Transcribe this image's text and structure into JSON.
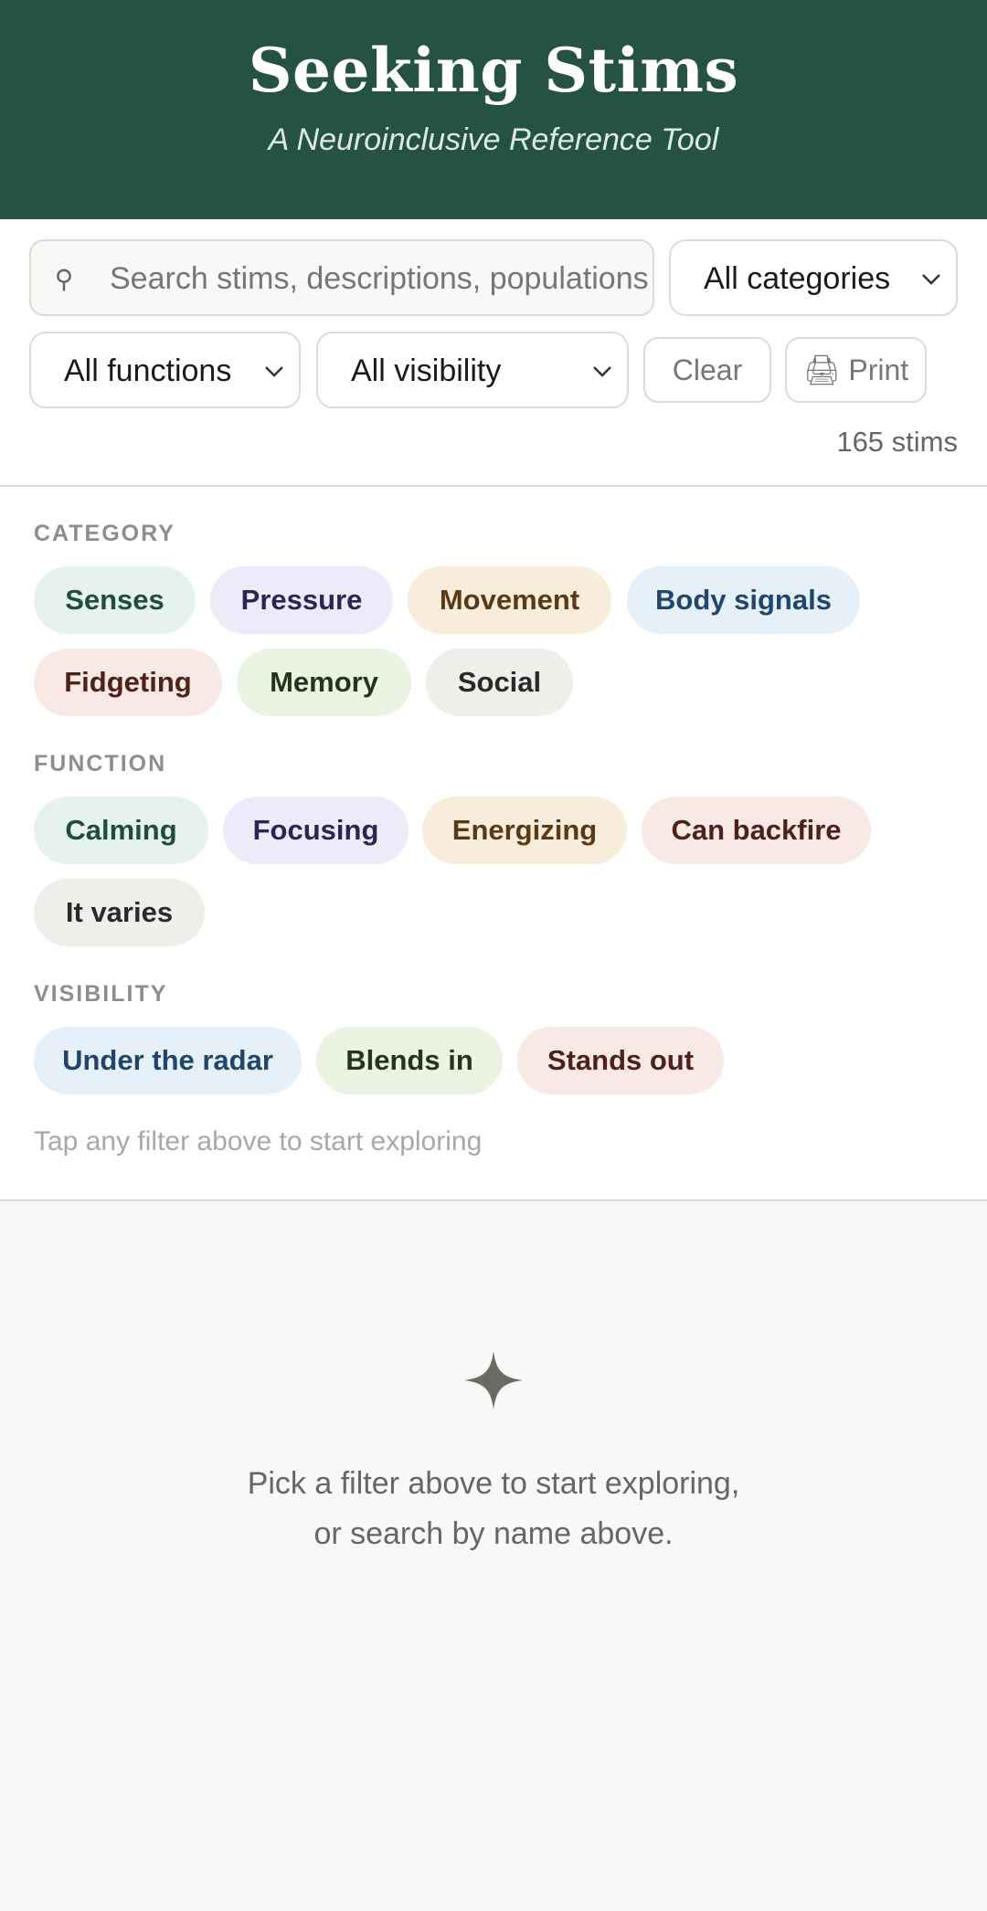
{
  "header": {
    "title": "Seeking Stims",
    "subtitle": "A Neuroinclusive Reference Tool"
  },
  "search": {
    "placeholder": "Search stims, descriptions, populations…",
    "icon": "search-icon"
  },
  "selects": {
    "categories": "All categories",
    "functions": "All functions",
    "visibility": "All visibility"
  },
  "buttons": {
    "clear": "Clear",
    "print": "🖨 Print"
  },
  "count_label": "165 stims",
  "filters": {
    "category": {
      "label": "CATEGORY",
      "chips": [
        {
          "label": "Senses",
          "bg": "#e6f3ed",
          "fg": "#1f4d3f"
        },
        {
          "label": "Pressure",
          "bg": "#ecebfa",
          "fg": "#2a2555"
        },
        {
          "label": "Movement",
          "bg": "#f8ecda",
          "fg": "#5a3a16"
        },
        {
          "label": "Body signals",
          "bg": "#e6f0f9",
          "fg": "#21466b"
        },
        {
          "label": "Fidgeting",
          "bg": "#f8e9e6",
          "fg": "#4e2219"
        },
        {
          "label": "Memory",
          "bg": "#ebf3e2",
          "fg": "#24361a"
        },
        {
          "label": "Social",
          "bg": "#efeeeb",
          "fg": "#2a2a2a"
        }
      ]
    },
    "function": {
      "label": "FUNCTION",
      "chips": [
        {
          "label": "Calming",
          "bg": "#e6f3ed",
          "fg": "#1f4d3f"
        },
        {
          "label": "Focusing",
          "bg": "#ecebfa",
          "fg": "#2a2555"
        },
        {
          "label": "Energizing",
          "bg": "#f8ecda",
          "fg": "#5a3a16"
        },
        {
          "label": "Can backfire",
          "bg": "#f8e9e6",
          "fg": "#4e2219"
        },
        {
          "label": "It varies",
          "bg": "#efeeeb",
          "fg": "#2a2a2a"
        }
      ]
    },
    "visibility": {
      "label": "VISIBILITY",
      "chips": [
        {
          "label": "Under the radar",
          "bg": "#e6f0f9",
          "fg": "#21466b"
        },
        {
          "label": "Blends in",
          "bg": "#ebf3e2",
          "fg": "#24361a"
        },
        {
          "label": "Stands out",
          "bg": "#f8e9e6",
          "fg": "#4e2219"
        }
      ]
    },
    "hint": "Tap any filter above to start exploring"
  },
  "empty_state": {
    "icon": "sparkle-icon",
    "line1": "Pick a filter above to start exploring,",
    "line2": "or search by name above."
  },
  "colors": {
    "header_bg": "#265244",
    "page_bg": "#f8f8f6"
  }
}
